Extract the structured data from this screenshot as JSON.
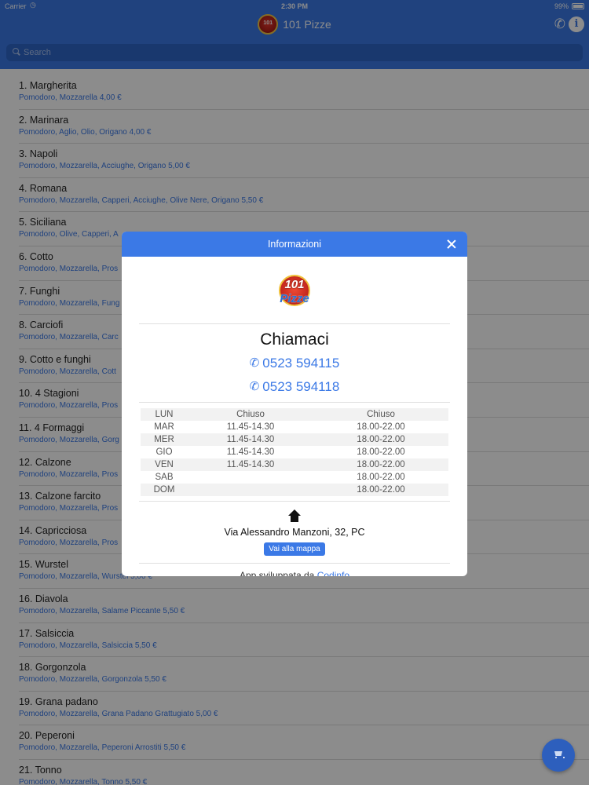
{
  "status_bar": {
    "carrier": "Carrier",
    "time": "2:30 PM",
    "battery": "99%"
  },
  "header": {
    "logo_text": "101",
    "title": "101 Pizze"
  },
  "search": {
    "placeholder": "Search"
  },
  "menu": [
    {
      "name": "1. Margherita",
      "desc": "Pomodoro, Mozzarella 4,00 €"
    },
    {
      "name": "2. Marinara",
      "desc": "Pomodoro, Aglio, Olio, Origano 4,00 €"
    },
    {
      "name": "3. Napoli",
      "desc": "Pomodoro, Mozzarella, Acciughe, Origano 5,00 €"
    },
    {
      "name": "4. Romana",
      "desc": "Pomodoro, Mozzarella, Capperi, Acciughe, Olive Nere, Origano 5,50 €"
    },
    {
      "name": "5. Siciliana",
      "desc": "Pomodoro, Olive, Capperi, A"
    },
    {
      "name": "6. Cotto",
      "desc": "Pomodoro, Mozzarella, Pros"
    },
    {
      "name": "7. Funghi",
      "desc": "Pomodoro, Mozzarella, Fung"
    },
    {
      "name": "8. Carciofi",
      "desc": "Pomodoro, Mozzarella, Carc"
    },
    {
      "name": "9. Cotto e funghi",
      "desc": "Pomodoro, Mozzarella, Cott"
    },
    {
      "name": "10. 4 Stagioni",
      "desc": "Pomodoro, Mozzarella, Pros"
    },
    {
      "name": "11. 4 Formaggi",
      "desc": "Pomodoro, Mozzarella, Gorg"
    },
    {
      "name": "12. Calzone",
      "desc": "Pomodoro, Mozzarella, Pros"
    },
    {
      "name": "13. Calzone farcito",
      "desc": "Pomodoro, Mozzarella, Pros"
    },
    {
      "name": "14. Capricciosa",
      "desc": "Pomodoro, Mozzarella, Pros"
    },
    {
      "name": "15. Wurstel",
      "desc": "Pomodoro, Mozzarella, Wurstel 5,00 €"
    },
    {
      "name": "16. Diavola",
      "desc": "Pomodoro, Mozzarella, Salame Piccante 5,50 €"
    },
    {
      "name": "17. Salsiccia",
      "desc": "Pomodoro, Mozzarella, Salsiccia 5,50 €"
    },
    {
      "name": "18. Gorgonzola",
      "desc": "Pomodoro, Mozzarella, Gorgonzola 5,50 €"
    },
    {
      "name": "19. Grana padano",
      "desc": "Pomodoro, Mozzarella, Grana Padano Grattugiato 5,00 €"
    },
    {
      "name": "20. Peperoni",
      "desc": "Pomodoro, Mozzarella, Peperoni Arrostiti 5,50 €"
    },
    {
      "name": "21. Tonno",
      "desc": "Pomodoro, Mozzarella, Tonno 5,50 €"
    }
  ],
  "modal": {
    "title": "Informazioni",
    "logo_number": "101",
    "logo_word": "Pizze",
    "call_title": "Chiamaci",
    "phones": [
      "0523 594115",
      "0523 594118"
    ],
    "hours": [
      {
        "day": "LUN",
        "am": "Chiuso",
        "pm": "Chiuso"
      },
      {
        "day": "MAR",
        "am": "11.45-14.30",
        "pm": "18.00-22.00"
      },
      {
        "day": "MER",
        "am": "11.45-14.30",
        "pm": "18.00-22.00"
      },
      {
        "day": "GIO",
        "am": "11.45-14.30",
        "pm": "18.00-22.00"
      },
      {
        "day": "VEN",
        "am": "11.45-14.30",
        "pm": "18.00-22.00"
      },
      {
        "day": "SAB",
        "am": "",
        "pm": "18.00-22.00"
      },
      {
        "day": "DOM",
        "am": "",
        "pm": "18.00-22.00"
      }
    ],
    "address": "Via Alessandro Manzoni, 32, PC",
    "map_button": "Vai alla mappa",
    "footer_prefix": "App sviluppata da ",
    "footer_link": "Codinfo"
  },
  "colors": {
    "accent": "#3b79e6",
    "overlay": "rgba(0,0,0,0.45)"
  },
  "icons": {
    "phone": "phone-icon",
    "info": "info-icon",
    "search": "search-icon",
    "close": "close-icon",
    "home": "home-icon",
    "cart": "cart-icon"
  }
}
